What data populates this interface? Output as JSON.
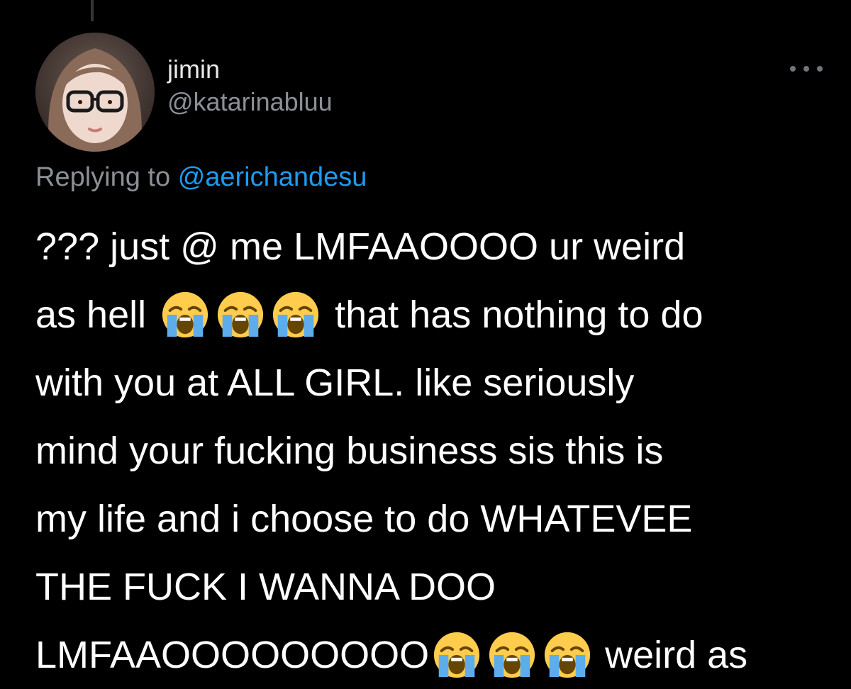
{
  "tweet": {
    "display_name": "jimin",
    "handle": "@katarinabluu",
    "replying_prefix": "Replying to",
    "replying_handle": "@aerichandesu",
    "more_icon": "ellipsis-icon",
    "emoji_icon": "loudly-crying-face-icon",
    "lines": [
      "??? just @ me LMFAAOOOO ur weird",
      "as hell",
      "that has nothing to do",
      "with you at ALL GIRL. like seriously",
      "mind your fucking business sis this is",
      "my life and i choose to do WHATEVEE",
      "THE FUCK I WANNA DOO",
      "LMFAAOOOOOOOOO",
      "weird as"
    ]
  },
  "colors": {
    "background": "#000000",
    "text": "#ffffff",
    "secondary": "#8b9096",
    "link": "#1d9bf0"
  }
}
